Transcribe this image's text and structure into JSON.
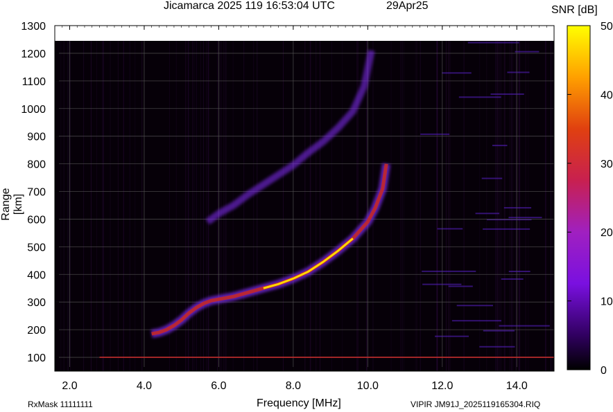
{
  "header": {
    "title": "Jicamarca 2025 119 16:53:04 UTC",
    "date": "29Apr25"
  },
  "footer": {
    "rxmask": "RxMask 11111111",
    "filename": "VIPIR  JM91J_2025119165304.RIQ"
  },
  "colors": {
    "background": "#000000",
    "grid": "#555555",
    "trace_core": "#ffd800",
    "trace_mid": "#c22828",
    "trace_halo": "#7a2ae6"
  },
  "chart_data": {
    "type": "heatmap",
    "title": "Jicamarca 2025 119 16:53:04 UTC",
    "xlabel": "Frequency [MHz]",
    "ylabel": "Range [km]",
    "xlim": [
      1.6,
      15.0
    ],
    "ylim": [
      50,
      1300
    ],
    "x_ticks": [
      "2.0",
      "4.0",
      "6.0",
      "8.0",
      "10.0",
      "12.0",
      "14.0"
    ],
    "x_tick_values": [
      2,
      4,
      6,
      8,
      10,
      12,
      14
    ],
    "y_ticks": [
      "100",
      "200",
      "300",
      "400",
      "500",
      "600",
      "700",
      "800",
      "900",
      "1000",
      "1100",
      "1200",
      "1300"
    ],
    "y_tick_values": [
      100,
      200,
      300,
      400,
      500,
      600,
      700,
      800,
      900,
      1000,
      1100,
      1200,
      1300
    ],
    "grid": true,
    "colorbar": {
      "label": "SNR [dB]",
      "range": [
        0,
        50
      ],
      "ticks": [
        "0",
        "10",
        "20",
        "30",
        "40",
        "50"
      ],
      "tick_values": [
        0,
        10,
        20,
        30,
        40,
        50
      ]
    },
    "series": [
      {
        "x": [
          4.2,
          4.4,
          4.6,
          4.8,
          5.0,
          5.2,
          5.4,
          5.6,
          5.8,
          6.0,
          6.4,
          6.8,
          7.2,
          7.6,
          8.0,
          8.4,
          8.8,
          9.2,
          9.6,
          10.0,
          10.2,
          10.4,
          10.5
        ],
        "y": [
          185,
          190,
          200,
          215,
          235,
          260,
          280,
          295,
          305,
          310,
          320,
          335,
          350,
          365,
          385,
          410,
          445,
          485,
          530,
          590,
          640,
          710,
          800
        ]
      },
      {
        "x": [
          5.7,
          6.0,
          6.4,
          6.8,
          7.2,
          7.6,
          8.0,
          8.4,
          8.8,
          9.2,
          9.6,
          9.9,
          10.1
        ],
        "y": [
          590,
          620,
          650,
          690,
          725,
          760,
          795,
          840,
          880,
          930,
          990,
          1080,
          1210
        ]
      },
      {
        "x": [
          2.8,
          3.5,
          4.0,
          5.0,
          6.0,
          7.0,
          8.0,
          9.0,
          10.0,
          11.0,
          12.0,
          13.0,
          14.0,
          15.0
        ],
        "y": [
          100,
          100,
          100,
          100,
          100,
          100,
          100,
          100,
          100,
          100,
          100,
          100,
          100,
          100
        ]
      }
    ]
  }
}
